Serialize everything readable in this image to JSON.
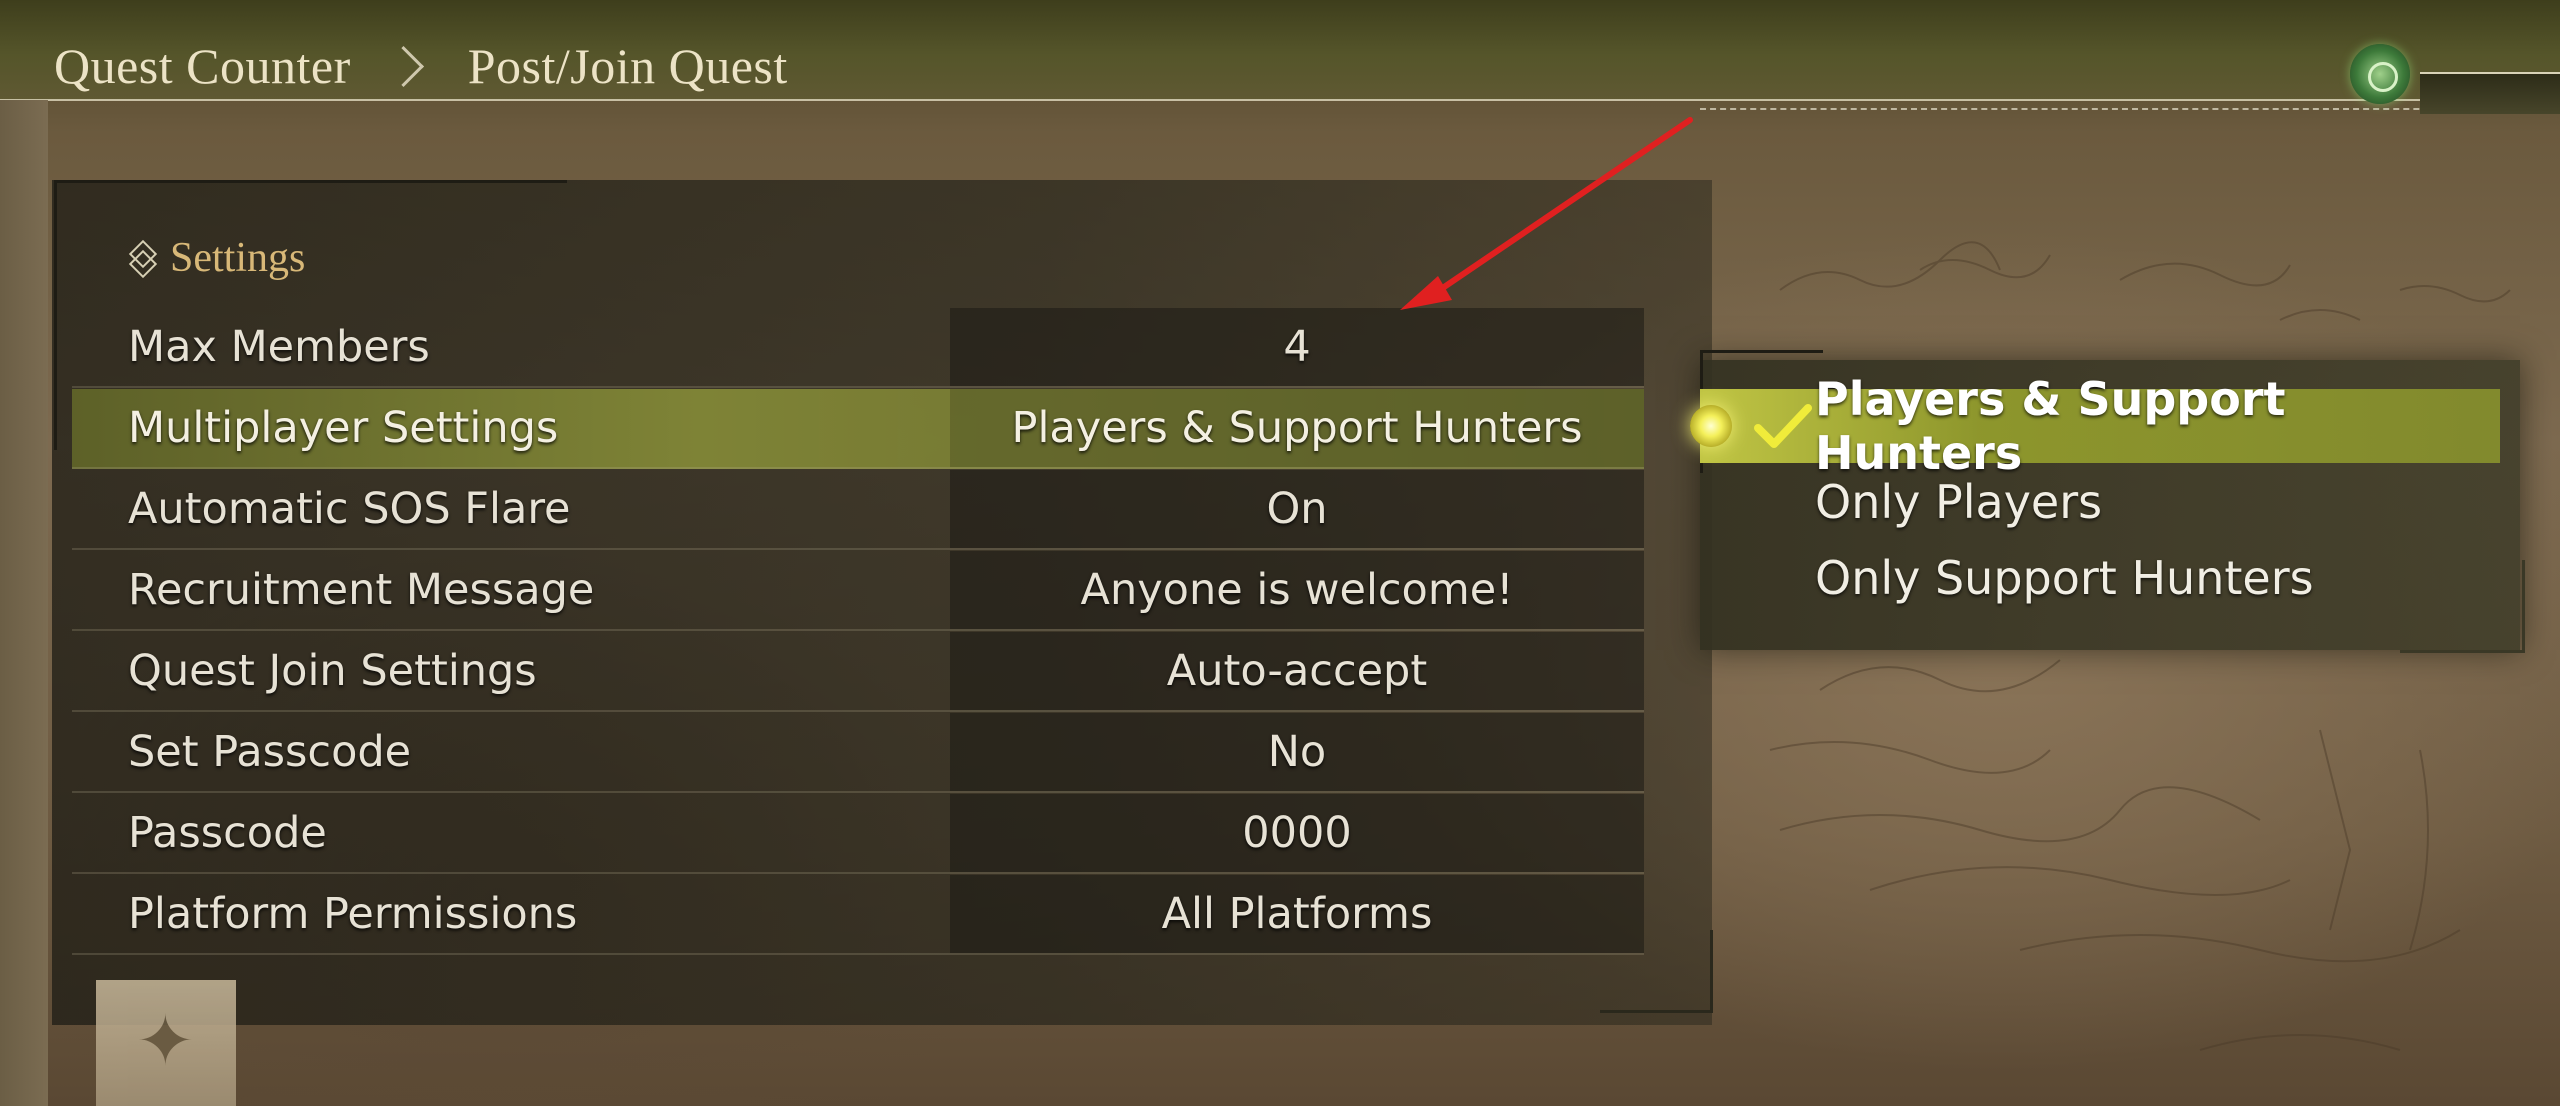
{
  "breadcrumb": {
    "items": [
      "Quest Counter",
      "Post/Join Quest"
    ]
  },
  "section": {
    "title": "Settings",
    "icon": "layers-icon"
  },
  "settings": [
    {
      "label": "Max Members",
      "value": "4"
    },
    {
      "label": "Multiplayer Settings",
      "value": "Players & Support Hunters",
      "selected": true
    },
    {
      "label": "Automatic SOS Flare",
      "value": "On"
    },
    {
      "label": "Recruitment Message",
      "value": "Anyone is welcome!"
    },
    {
      "label": "Quest Join Settings",
      "value": "Auto-accept"
    },
    {
      "label": "Set Passcode",
      "value": "No"
    },
    {
      "label": "Passcode",
      "value": "0000"
    },
    {
      "label": "Platform Permissions",
      "value": "All Platforms"
    }
  ],
  "options": {
    "items": [
      {
        "label": "Players & Support Hunters",
        "checked": true
      },
      {
        "label": "Only Players",
        "checked": false
      },
      {
        "label": "Only Support Hunters",
        "checked": false
      }
    ]
  },
  "colors": {
    "selection_highlight": "#7d8237",
    "option_highlight": "#c8cd46",
    "section_title": "#d8b878",
    "annotation_arrow": "#e02020"
  }
}
